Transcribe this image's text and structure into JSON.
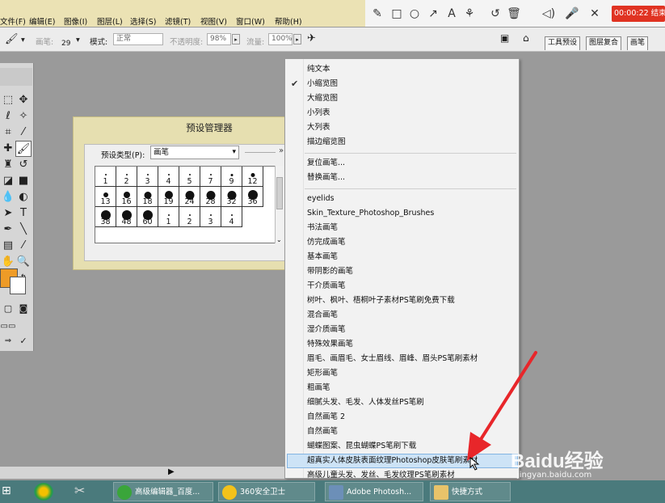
{
  "menubar": {
    "items": [
      "文件(F)",
      "编辑(E)",
      "图像(I)",
      "图层(L)",
      "选择(S)",
      "滤镜(T)",
      "视图(V)",
      "窗口(W)",
      "帮助(H)"
    ]
  },
  "recorder": {
    "timer": "00:00:22 结束",
    "icons": [
      "pen-icon",
      "rectangle-icon",
      "circle-icon",
      "arrow-icon",
      "text-icon",
      "brush-icon",
      "undo-icon",
      "delete-icon",
      "speaker-icon",
      "microphone-icon",
      "close-icon"
    ]
  },
  "options": {
    "brush_label": "画笔:",
    "brush_size": "29",
    "mode_label": "模式:",
    "mode_value": "正常",
    "opacity_label": "不透明度:",
    "opacity_value": "98%",
    "flow_label": "流量:",
    "flow_value": "100%",
    "tabs": [
      "工具预设",
      "图层复合",
      "画笔"
    ]
  },
  "dialog": {
    "title": "预设管理器",
    "preset_type_label": "预设类型(P):",
    "preset_type_value": "画笔",
    "brushes": [
      {
        "label": "1",
        "d": 1
      },
      {
        "label": "2",
        "d": 1
      },
      {
        "label": "3",
        "d": 1
      },
      {
        "label": "4",
        "d": 1
      },
      {
        "label": "5",
        "d": 2
      },
      {
        "label": "7",
        "d": 2
      },
      {
        "label": "9",
        "d": 3
      },
      {
        "label": "12",
        "d": 5
      },
      {
        "label": "13",
        "d": 6
      },
      {
        "label": "16",
        "d": 8
      },
      {
        "label": "18",
        "d": 9
      },
      {
        "label": "19",
        "d": 10
      },
      {
        "label": "24",
        "d": 11
      },
      {
        "label": "28",
        "d": 11
      },
      {
        "label": "32",
        "d": 11
      },
      {
        "label": "36",
        "d": 12
      },
      {
        "label": "38",
        "d": 12
      },
      {
        "label": "48",
        "d": 12
      },
      {
        "label": "60",
        "d": 12
      },
      {
        "label": "1",
        "d": 1
      },
      {
        "label": "2",
        "d": 1
      },
      {
        "label": "3",
        "d": 1
      },
      {
        "label": "4",
        "d": 1
      }
    ]
  },
  "menu": {
    "view_items": [
      "纯文本",
      "小缩览图",
      "大缩览图",
      "小列表",
      "大列表",
      "描边缩览图"
    ],
    "checked_index": 1,
    "action_items": [
      "复位画笔...",
      "替换画笔..."
    ],
    "library_items": [
      "eyelids",
      "Skin_Texture_Photoshop_Brushes",
      "书法画笔",
      "仿完成画笔",
      "基本画笔",
      "带阴影的画笔",
      "干介质画笔",
      "树叶、枫叶、梧桐叶子素材PS笔刷免费下载",
      "混合画笔",
      "湿介质画笔",
      "特殊效果画笔",
      "眉毛、画眉毛、女士眉线、眉峰、眉头PS笔刷素材",
      "矩形画笔",
      "粗画笔",
      "细腻头发、毛发、人体发丝PS笔刷",
      "自然画笔 2",
      "自然画笔",
      "蝴蝶图案、昆虫蝴蝶PS笔刷下载",
      "超真实人体皮肤表面纹理Photoshop皮肤笔刷素材",
      "高级儿童头发、发丝、毛发纹理PS笔刷素材"
    ],
    "highlighted_index": 18
  },
  "taskbar": {
    "items": [
      "高级编辑器_百度...",
      "360安全卫士",
      "Adobe Photosh...",
      "快捷方式"
    ]
  },
  "watermark": {
    "brand": "Baidu经验",
    "url": "jingyan.baidu.com"
  },
  "colors": {
    "foreground": "#ee9b27",
    "background": "#ffffff",
    "highlight": "#cde3f6",
    "timer": "#e03322",
    "arrow": "#e8262a"
  }
}
